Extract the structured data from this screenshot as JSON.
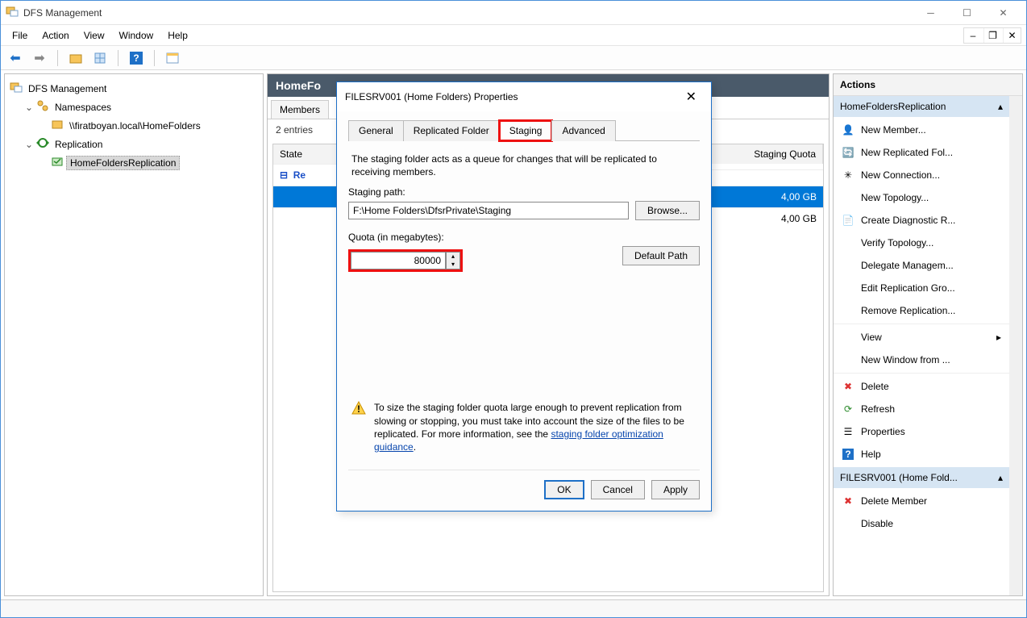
{
  "window": {
    "title": "DFS Management"
  },
  "menubar": {
    "items": [
      "File",
      "Action",
      "View",
      "Window",
      "Help"
    ]
  },
  "tree": {
    "root": "DFS Management",
    "namespaces": "Namespaces",
    "namespace_path": "\\\\firatboyan.local\\HomeFolders",
    "replication": "Replication",
    "replication_group": "HomeFoldersReplication"
  },
  "center": {
    "header": "HomeFoldersReplication",
    "header_visible": "HomeFo",
    "tabs": [
      "Members"
    ],
    "entries": "2 entries",
    "columns": {
      "state": "State",
      "staging_quota": "Staging Quota"
    },
    "rows": [
      {
        "state": "Re",
        "expander": "⊟",
        "quota": "4,00 GB",
        "selected": true
      },
      {
        "quota": "4,00 GB",
        "selected": false
      }
    ]
  },
  "actions": {
    "title": "Actions",
    "section1": "HomeFoldersReplication",
    "section2": "FILESRV001 (Home Fold...",
    "group1": [
      "New Member...",
      "New Replicated Fol...",
      "New Connection...",
      "New Topology...",
      "Create Diagnostic R...",
      "Verify Topology...",
      "Delegate Managem...",
      "Edit Replication Gro...",
      "Remove Replication..."
    ],
    "group1b": [
      "View",
      "New Window from ..."
    ],
    "group1c": [
      "Delete",
      "Refresh",
      "Properties",
      "Help"
    ],
    "group2": [
      "Delete Member",
      "Disable"
    ]
  },
  "dialog": {
    "title": "FILESRV001 (Home Folders) Properties",
    "tabs": [
      "General",
      "Replicated Folder",
      "Staging",
      "Advanced"
    ],
    "active_tab": "Staging",
    "desc": "The staging folder acts as a queue for changes that will be replicated to receiving members.",
    "staging_path_label": "Staging path:",
    "staging_path_value": "F:\\Home Folders\\DfsrPrivate\\Staging",
    "browse": "Browse...",
    "quota_label": "Quota (in megabytes):",
    "quota_value": "80000",
    "default_path": "Default Path",
    "warning": "To size the staging folder quota large enough to prevent replication from slowing or stopping, you must take into account the size of the files to be replicated. For more information, see the ",
    "warning_link": "staging folder optimization guidance",
    "warning_end": ".",
    "ok": "OK",
    "cancel": "Cancel",
    "apply": "Apply"
  }
}
